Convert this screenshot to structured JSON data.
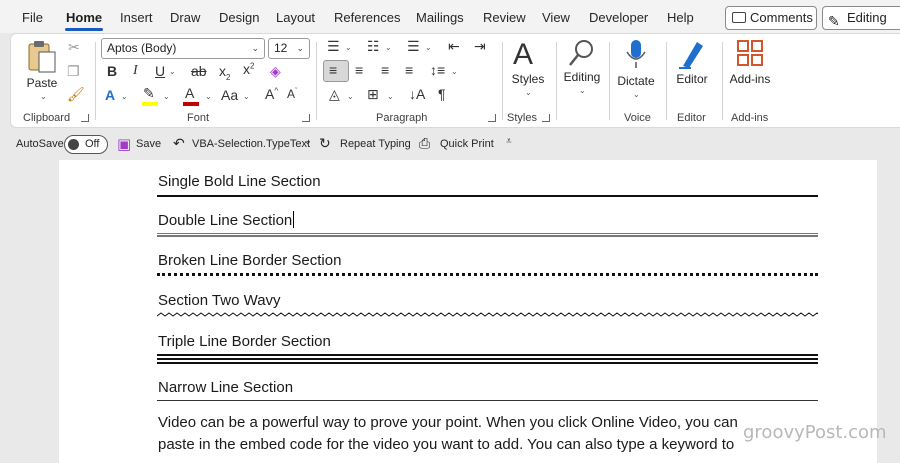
{
  "menu": {
    "tabs": [
      {
        "label": "File"
      },
      {
        "label": "Home"
      },
      {
        "label": "Insert"
      },
      {
        "label": "Draw"
      },
      {
        "label": "Design"
      },
      {
        "label": "Layout"
      },
      {
        "label": "References"
      },
      {
        "label": "Mailings"
      },
      {
        "label": "Review"
      },
      {
        "label": "View"
      },
      {
        "label": "Developer"
      },
      {
        "label": "Help"
      }
    ],
    "active_tab": "Home",
    "comments_label": "Comments",
    "editing_label": "Editing"
  },
  "ribbon": {
    "clipboard": {
      "paste_label": "Paste",
      "group_label": "Clipboard"
    },
    "font": {
      "font_name": "Aptos (Body)",
      "font_size": "12",
      "group_label": "Font"
    },
    "paragraph": {
      "group_label": "Paragraph"
    },
    "styles": {
      "styles_label": "Styles",
      "group_label": "Styles"
    },
    "editing": {
      "editing_label": "Editing"
    },
    "voice": {
      "dictate_label": "Dictate",
      "group_label": "Voice"
    },
    "editor": {
      "editor_label": "Editor",
      "group_label": "Editor"
    },
    "addins": {
      "addins_label": "Add-ins",
      "group_label": "Add-ins"
    }
  },
  "qat": {
    "autosave_label": "AutoSave",
    "autosave_state": "Off",
    "save_label": "Save",
    "vba_label": "VBA-Selection.TypeText",
    "repeat_label": "Repeat Typing",
    "quickprint_label": "Quick Print"
  },
  "document": {
    "sections": [
      "Single Bold Line Section",
      "Double Line Section",
      "Broken Line Border Section",
      "Section Two Wavy",
      "Triple Line Border Section",
      "Narrow Line Section"
    ],
    "paragraph_lines": [
      "Video can be a powerful way to prove your point. When you click Online Video, you can",
      "paste in the embed code for the video you want to add. You can also type a keyword to"
    ]
  },
  "watermark": "groovyPost.com",
  "colors": {
    "accent": "#185abd",
    "font_red": "#c00000",
    "highlight_yellow": "#ffff00"
  }
}
